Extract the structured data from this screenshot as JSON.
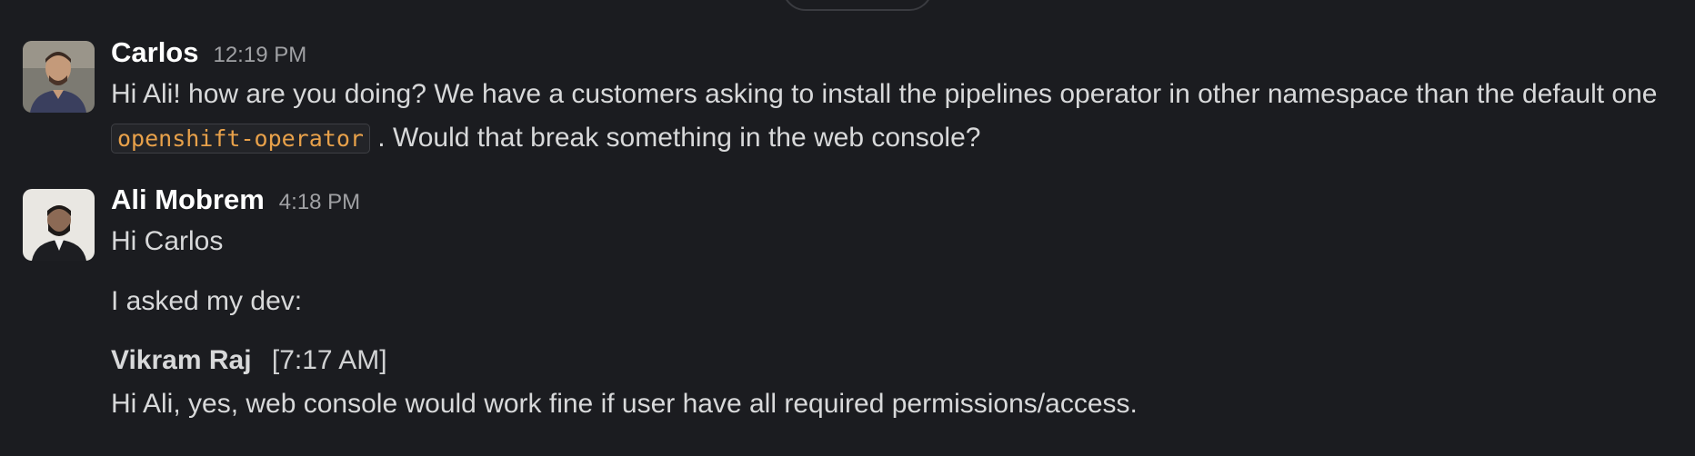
{
  "messages": [
    {
      "author": "Carlos",
      "time": "12:19 PM",
      "text_before_code": "Hi Ali! how are you doing? We have a customers asking to install the pipelines operator in other namespace than the default one ",
      "code": "openshift-operator",
      "text_after_code": " . Would that break something in the web console?"
    },
    {
      "author": "Ali Mobrem",
      "time": "4:18 PM",
      "line1": "Hi Carlos",
      "line2": "I asked my dev:",
      "quote": {
        "author": "Vikram Raj",
        "time": "[7:17 AM]",
        "text": "Hi Ali, yes, web console would work fine if user have all required permissions/access."
      }
    }
  ],
  "colors": {
    "background": "#1b1c20",
    "author": "#ffffff",
    "timestamp": "#a0a1a4",
    "code": "#e8a14a"
  }
}
